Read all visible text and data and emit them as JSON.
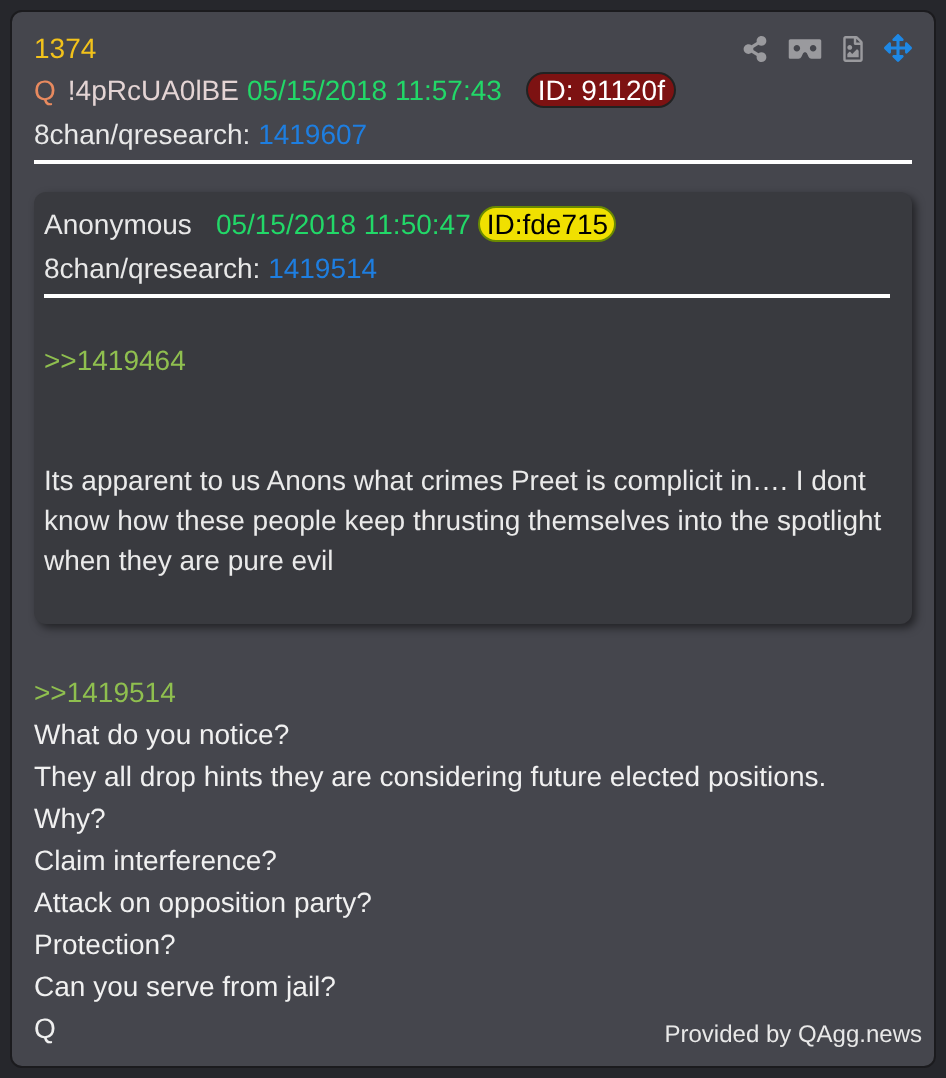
{
  "post": {
    "number": "1374",
    "author": "Q",
    "tripcode": "!4pRcUA0lBE",
    "date": "05/15/2018 11:57:43",
    "id": "ID: 91120f",
    "board": "8chan/qresearch:",
    "post_link": "1419607"
  },
  "quoted_post": {
    "author": "Anonymous",
    "date": "05/15/2018 11:50:47",
    "id": "ID:fde715",
    "board": "8chan/qresearch:",
    "post_link": "1419514",
    "reply_to": ">>1419464",
    "text": "Its apparent to us Anons what crimes Preet is complicit in…. I dont know how these people keep thrusting themselves into the spotlight when they are pure evil"
  },
  "message": [
    {
      "kind": "quote",
      "text": ">>1419514"
    },
    {
      "kind": "line",
      "text": "What do you notice?"
    },
    {
      "kind": "line",
      "text": "They all drop hints they are considering future elected positions."
    },
    {
      "kind": "line",
      "text": "Why?"
    },
    {
      "kind": "line",
      "text": "Claim interference?"
    },
    {
      "kind": "line",
      "text": "Attack on opposition party?"
    },
    {
      "kind": "line",
      "text": "Protection?"
    },
    {
      "kind": "line",
      "text": "Can you serve from jail?"
    },
    {
      "kind": "line",
      "text": "Q"
    }
  ],
  "footer": "Provided by QAgg.news"
}
